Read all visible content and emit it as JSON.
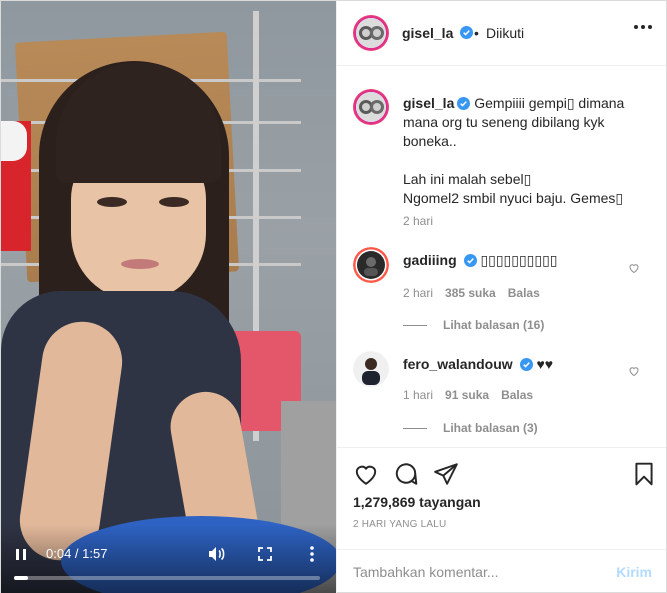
{
  "post": {
    "username": "gisel_la",
    "separator": "•",
    "follow_status": "Diikuti"
  },
  "video": {
    "time": "0:04 / 1:57",
    "progress": 0.045
  },
  "caption": {
    "username": "gisel_la",
    "text": "Gempiiii gempi▯ dimana mana org tu seneng dibilang kyk boneka..\n\nLah ini malah sebel▯\nNgomel2 smbil nyuci baju. Gemes▯",
    "time_ago": "2 hari"
  },
  "comments": [
    {
      "username": "gadiiing",
      "text": "▯▯▯▯▯▯▯▯▯▯",
      "time_ago": "2 hari",
      "likes": "385 suka",
      "reply_label": "Balas",
      "view_replies": "Lihat balasan (16)"
    },
    {
      "username": "fero_walandouw",
      "text": "♥♥",
      "time_ago": "1 hari",
      "likes": "91 suka",
      "reply_label": "Balas",
      "view_replies": "Lihat balasan (3)"
    }
  ],
  "stats": {
    "views": "1,279,869 tayangan",
    "date": "2 HARI YANG LALU"
  },
  "compose": {
    "placeholder": "Tambahkan komentar...",
    "send_label": "Kirim"
  },
  "colors": {
    "verified": "#3897f0",
    "send_disabled": "#b3dbff",
    "muted": "#8e8e8e"
  }
}
